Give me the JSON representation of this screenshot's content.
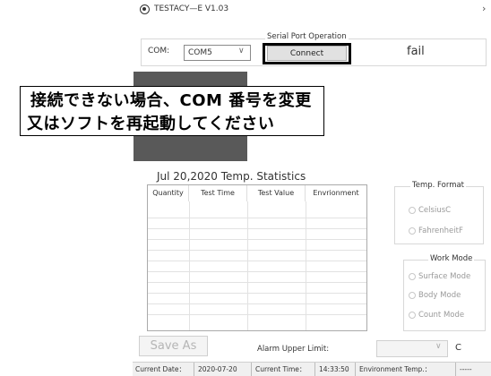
{
  "window": {
    "title": "TESTACY—E  V1.03"
  },
  "serial": {
    "caption": "Serial Port Operation",
    "com_label": "COM:",
    "com_value": "COM5",
    "connect_label": "Connect",
    "status": "fail"
  },
  "callout": {
    "line1": "接続できない場合、COM 番号を変更",
    "line2": "又はソフトを再起動してください"
  },
  "stats": {
    "title": "Jul 20,2020 Temp. Statistics"
  },
  "table": {
    "headers": [
      "Quantity",
      "Test Time",
      "Test Value",
      "Envrionment"
    ]
  },
  "temp_format": {
    "caption": "Temp. Format",
    "options": [
      "CelsiusC",
      "FahrenheitF"
    ]
  },
  "work_mode": {
    "caption": "Work Mode",
    "options": [
      "Surface Mode",
      "Body Mode",
      "Count Mode"
    ]
  },
  "bottom": {
    "save_label": "Save As",
    "alarm_label": "Alarm Upper Limit:",
    "alarm_value": "",
    "alarm_unit": "C"
  },
  "statusbar": {
    "date_label": "Current Date：",
    "date_value": "2020-07-20",
    "time_label": "Current Time：",
    "time_value": "14:33:50",
    "env_label": "Environment Temp.：",
    "env_value": "-----"
  },
  "colors": {
    "display": "#595959",
    "highlight_border": "#000000"
  }
}
